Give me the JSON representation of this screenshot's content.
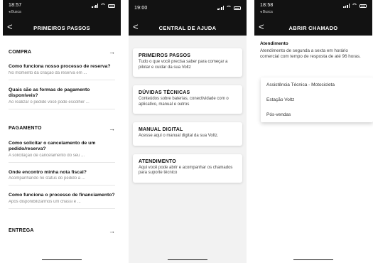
{
  "screen1": {
    "status": {
      "time": "18:57",
      "sub": "◂ Busca"
    },
    "nav": {
      "back": "<",
      "title": "PRIMEIROS PASSOS"
    },
    "sections": [
      {
        "label": "COMPRA",
        "arrow": "→",
        "questions": [
          {
            "q": "Como funciona nosso processo de reserva?",
            "a": "No momento da criação da reserva em ..."
          },
          {
            "q": "Quais são as formas de pagamento disponíveis?",
            "a": "Ao realizar o pedido você pode escolher ..."
          }
        ]
      },
      {
        "label": "PAGAMENTO",
        "arrow": "→",
        "questions": [
          {
            "q": "Como solicitar o cancelamento de um pedido/reserva?",
            "a": "A solicitação de cancelamento do seu ..."
          },
          {
            "q": "Onde encontro minha nota fiscal?",
            "a": "Acompanhando no status do pedido a ..."
          },
          {
            "q": "Como funciona o processo de financiamento?",
            "a": "Após disponibilizarmos um chassi e ..."
          }
        ]
      },
      {
        "label": "ENTREGA",
        "arrow": "→",
        "questions": []
      }
    ]
  },
  "screen2": {
    "status": {
      "time": "19:00",
      "sub": ""
    },
    "nav": {
      "back": "<",
      "title": "CENTRAL DE AJUDA"
    },
    "cards": [
      {
        "title": "PRIMEIROS PASSOS",
        "desc": "Tudo o que você precisa saber para começar a pilotar e cuidar da sua Voltz"
      },
      {
        "title": "DÚVIDAS TÉCNICAS",
        "desc": "Conteúdos sobre baterias, conectividade com o aplicativo, manual e outros"
      },
      {
        "title": "MANUAL DIGITAL",
        "desc": "Acesse aqui o manual digital da sua Voltz."
      },
      {
        "title": "ATENDIMENTO",
        "desc": "Aqui você pode abrir e acompanhar os chamados para suporte técnico"
      }
    ]
  },
  "screen3": {
    "status": {
      "time": "18:58",
      "sub": "◂ Busca"
    },
    "nav": {
      "back": "<",
      "title": "ABRIR CHAMADO"
    },
    "heading": "Atendimento",
    "description": "Atendimento de segunda a sexta em horário comercial com tempo de resposta de até 96 horas.",
    "options": [
      "Assistência Técnica - Motocicleta",
      "Estação Voltz",
      "Pós-vendas"
    ]
  }
}
